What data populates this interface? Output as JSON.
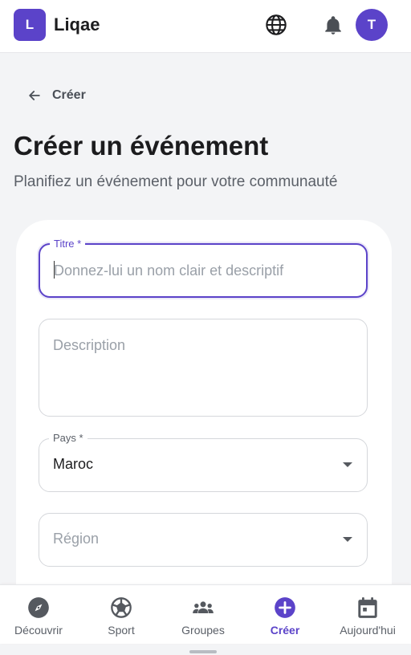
{
  "header": {
    "logo_letter": "L",
    "app_name": "Liqae",
    "avatar_letter": "T",
    "icons": [
      "globe-icon",
      "bell-icon"
    ]
  },
  "back": {
    "label": "Créer"
  },
  "page": {
    "title": "Créer un événement",
    "subtitle": "Planifiez un événement pour votre communauté"
  },
  "form": {
    "title_field": {
      "label": "Titre *",
      "value": "",
      "placeholder": "Donnez-lui un nom clair et descriptif"
    },
    "description_field": {
      "placeholder": "Description",
      "value": ""
    },
    "country_field": {
      "label": "Pays *",
      "value": "Maroc"
    },
    "region_field": {
      "placeholder": "Région",
      "value": ""
    }
  },
  "bottom_nav": {
    "items": [
      {
        "label": "Découvrir",
        "icon": "compass-icon",
        "active": false
      },
      {
        "label": "Sport",
        "icon": "soccer-ball-icon",
        "active": false
      },
      {
        "label": "Groupes",
        "icon": "groups-icon",
        "active": false
      },
      {
        "label": "Créer",
        "icon": "add-circle-icon",
        "active": true
      },
      {
        "label": "Aujourd'hui",
        "icon": "calendar-icon",
        "active": false
      }
    ]
  },
  "colors": {
    "accent": "#5b43c9",
    "background": "#f3f4f6",
    "card": "#ffffff"
  }
}
